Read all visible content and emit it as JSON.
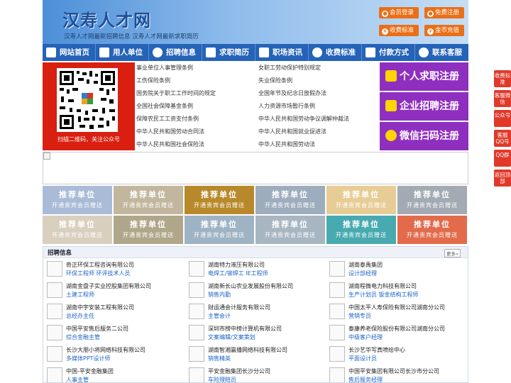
{
  "header": {
    "title": "汉寿人才网",
    "tagline": "汉寿人才网最新招聘信息   汉寿人才网最新求职简历",
    "buttons": [
      "会员登录",
      "免费注册",
      "收费标准",
      "金币充值"
    ]
  },
  "nav": [
    "网站首页",
    "用人单位",
    "招聘信息",
    "求职简历",
    "职场资讯",
    "收费标准",
    "付款方式",
    "联系客服"
  ],
  "qr": {
    "caption": "扫描二维码，关注公众号"
  },
  "links": {
    "left": [
      "事业单位人事管理条例",
      "工伤保险条例",
      "国务院关于职工工作时间的规定",
      "全国社会保障基金条例",
      "保障农民工工资支付条例",
      "中华人民共和国劳动合同法",
      "中华人民共和国社会保险法"
    ],
    "right": [
      "女职工劳动保护特别规定",
      "失业保险条例",
      "全国年节及纪念日放假办法",
      "人力资源市场暂行条例",
      "中华人民共和国劳动争议调解仲裁法",
      "中华人民共和国就业促进法",
      "中华人民共和国劳动法"
    ]
  },
  "register": [
    "个人求职注册",
    "企业招聘注册",
    "微信扫码注册"
  ],
  "tiles": {
    "title": "推荐单位",
    "subtitle": "开通贵宾会员赠送",
    "colors": [
      "#a9bbd6",
      "#c2b79e",
      "#b8892a",
      "#9eadbd",
      "#e8cc95",
      "#a4aab3",
      "#d8cfbf",
      "#b0a78a",
      "#9eb3c4",
      "#a8b6c2",
      "#47aab0",
      "#e26b4c"
    ]
  },
  "jobs": {
    "title": "招聘信息",
    "more": "更多»",
    "items": [
      {
        "company": "奇正环保工程咨询有限公司",
        "positions": "环保工程师 环评技术人员"
      },
      {
        "company": "湖南特力液压有限公司",
        "positions": "电焊工/铆焊工 IE工程师"
      },
      {
        "company": "湖南泰禹集团",
        "positions": "设计部经理"
      },
      {
        "company": "湖南金盘子实业控股集团有限公司",
        "positions": "土建工程师"
      },
      {
        "company": "湖南新长山农业发展股份有限公司",
        "positions": "销售内勤"
      },
      {
        "company": "湖南程微电力科技有限公司",
        "positions": "生产计划员 钣金结构工程师"
      },
      {
        "company": "湖南中宇安装工程有限公司",
        "positions": "总经办主任"
      },
      {
        "company": "财运通会计服务有限公司",
        "positions": "主管会计"
      },
      {
        "company": "中国太平人寿保险有限公司湖南分公司",
        "positions": "营销专员"
      },
      {
        "company": "中国平安售后服务二公司",
        "positions": "综合金融主管"
      },
      {
        "company": "深圳市榜中榜计算机有限公司",
        "positions": "文案编辑/文案策划"
      },
      {
        "company": "泰康养老保险股份有限公司湖南分公司",
        "positions": "中级客户经理"
      },
      {
        "company": "长沙大朋小将网络科技有限公司",
        "positions": "多媒体PPT设计师"
      },
      {
        "company": "湖南智湘赢播网络科技有限公司",
        "positions": "销售精英"
      },
      {
        "company": "长沙艺华写真喷绘中心",
        "positions": "平面设计员"
      },
      {
        "company": "中国-平安金融集团",
        "positions": "人事主管"
      },
      {
        "company": "平安金融集团长沙分公司",
        "positions": "车险理赔员"
      },
      {
        "company": "中国平安集团有限公司长沙市分公司",
        "positions": "售后服务经理"
      }
    ]
  },
  "float": [
    "收费标准",
    "客服微信",
    "公众号",
    "客服QQ号",
    "QQ群",
    "返回顶部"
  ]
}
